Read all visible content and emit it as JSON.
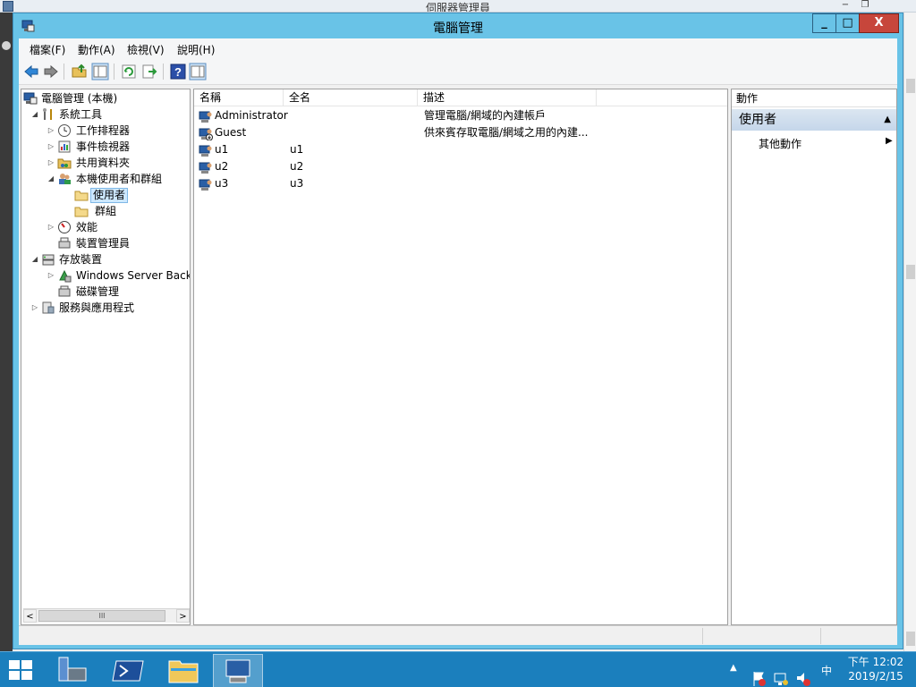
{
  "background_window": {
    "title": "伺服器管理員"
  },
  "window": {
    "title": "電腦管理",
    "controls": {
      "minimize": "_",
      "maximize": "□",
      "close": "X"
    }
  },
  "menu": [
    "檔案(F)",
    "動作(A)",
    "檢視(V)",
    "說明(H)"
  ],
  "toolbar": {
    "buttons": [
      "back-icon",
      "forward-icon",
      "up-folder-icon",
      "show-hide-tree-icon",
      "refresh-icon",
      "export-list-icon",
      "help-icon",
      "show-hide-action-pane-icon"
    ]
  },
  "tree": {
    "root": "電腦管理 (本機)",
    "system_tools": "系統工具",
    "task_scheduler": "工作排程器",
    "event_viewer": "事件檢視器",
    "shared_folders": "共用資料夾",
    "local_users_groups": "本機使用者和群組",
    "users": "使用者",
    "groups": "群組",
    "performance": "效能",
    "device_manager": "裝置管理員",
    "storage": "存放裝置",
    "windows_server_backup": "Windows Server Backu",
    "disk_management": "磁碟管理",
    "services_apps": "服務與應用程式"
  },
  "list": {
    "columns": [
      "名稱",
      "全名",
      "描述"
    ],
    "rows": [
      {
        "name": "Administrator",
        "full_name": "",
        "description": "管理電腦/網域的內建帳戶",
        "disabled": false
      },
      {
        "name": "Guest",
        "full_name": "",
        "description": "供來賓存取電腦/網域之用的內建...",
        "disabled": true
      },
      {
        "name": "u1",
        "full_name": "u1",
        "description": "",
        "disabled": false
      },
      {
        "name": "u2",
        "full_name": "u2",
        "description": "",
        "disabled": false
      },
      {
        "name": "u3",
        "full_name": "u3",
        "description": "",
        "disabled": false
      }
    ]
  },
  "actions": {
    "header": "動作",
    "group": "使用者",
    "more_actions": "其他動作"
  },
  "taskbar": {
    "ime": "中",
    "time": "下午 12:02",
    "date": "2019/2/15"
  },
  "colors": {
    "title_bar": "#69c3e7",
    "close_button": "#c7463b",
    "taskbar": "#1b7fbd",
    "selection": "#cde8ff"
  }
}
